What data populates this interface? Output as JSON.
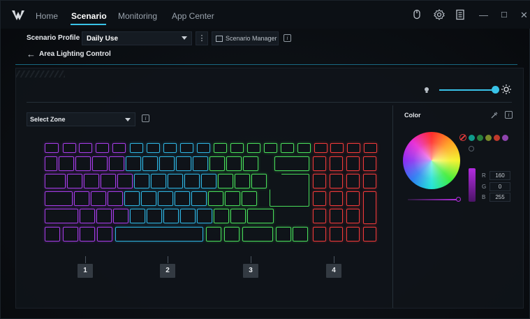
{
  "nav": {
    "tabs": [
      {
        "label": "Home"
      },
      {
        "label": "Scenario"
      },
      {
        "label": "Monitoring"
      },
      {
        "label": "App Center"
      }
    ]
  },
  "profile": {
    "label": "Scenario Profile",
    "value": "Daily Use",
    "manager_label": "Scenario Manager",
    "more_glyph": "⋮"
  },
  "page": {
    "back_glyph": "←",
    "title": "Area Lighting Control"
  },
  "zone_select": {
    "value": "Select Zone"
  },
  "zones": [
    {
      "label": "1"
    },
    {
      "label": "2"
    },
    {
      "label": "3"
    },
    {
      "label": "4"
    }
  ],
  "color_panel": {
    "title": "Color",
    "rgb": [
      {
        "channel": "R",
        "value": "160"
      },
      {
        "channel": "G",
        "value": "0"
      },
      {
        "channel": "B",
        "value": "255"
      }
    ],
    "swatches": [
      "#0e9b8c",
      "#2a7f3b",
      "#7a8a2a",
      "#c0392b",
      "#8e44ad"
    ]
  },
  "brightness": {
    "level": 1.0
  },
  "colors": {
    "accent": "#39c3e8",
    "zone1": "#a53ce6",
    "zone2": "#2fb3e0",
    "zone3": "#49dd5a",
    "zone4": "#f03a3a",
    "selected": "#a000ff"
  },
  "icons": {
    "logo": "predator-logo",
    "mouse": "mouse-icon",
    "settings": "gear-icon",
    "device": "device-icon",
    "minimize": "minimize-icon",
    "maximize": "maximize-icon",
    "close": "close-icon",
    "info": "info-icon",
    "eyedropper": "eyedropper-icon",
    "brightness_low": "bulb-icon",
    "brightness_high": "sun-icon"
  }
}
